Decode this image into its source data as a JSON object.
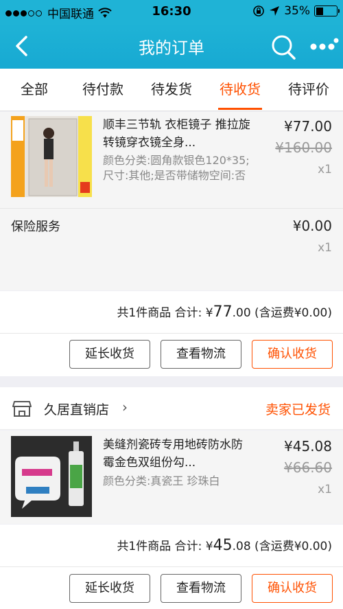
{
  "status_bar": {
    "carrier": "中国联通",
    "time": "16:30",
    "battery": "35%"
  },
  "nav": {
    "title": "我的订单"
  },
  "tabs": [
    {
      "label": "全部"
    },
    {
      "label": "待付款"
    },
    {
      "label": "待发货"
    },
    {
      "label": "待收货"
    },
    {
      "label": "待评价"
    }
  ],
  "order1": {
    "product": {
      "name": "顺丰三节轨 衣柜镜子 推拉旋转镜穿衣镜全身...",
      "sku": "颜色分类:圆角款银色120*35;尺寸:其他;是否带储物空间:否",
      "price": "¥77.00",
      "original_price": "¥160.00",
      "qty": "x1"
    },
    "insurance": {
      "name": "保险服务",
      "price": "¥0.00",
      "qty": "x1"
    },
    "summary": {
      "prefix": "共1件商品 合计: ¥",
      "int": "77",
      "dec": ".00",
      "suffix": " (含运费¥0.00)"
    },
    "buttons": {
      "extend": "延长收货",
      "logistics": "查看物流",
      "confirm": "确认收货"
    }
  },
  "order2": {
    "shop": {
      "name": "久居直销店",
      "status": "卖家已发货"
    },
    "product": {
      "name": "美缝剂瓷砖专用地砖防水防霉金色双组份勾...",
      "sku": "颜色分类:真瓷王 珍珠白",
      "price": "¥45.08",
      "original_price": "¥66.60",
      "qty": "x1"
    },
    "summary": {
      "prefix": "共1件商品 合计: ¥",
      "int": "45",
      "dec": ".08",
      "suffix": " (含运费¥0.00)"
    },
    "buttons": {
      "extend": "延长收货",
      "logistics": "查看物流",
      "confirm": "确认收货"
    }
  },
  "colors": {
    "brand": "#1fb3d6",
    "accent": "#ff5000"
  }
}
